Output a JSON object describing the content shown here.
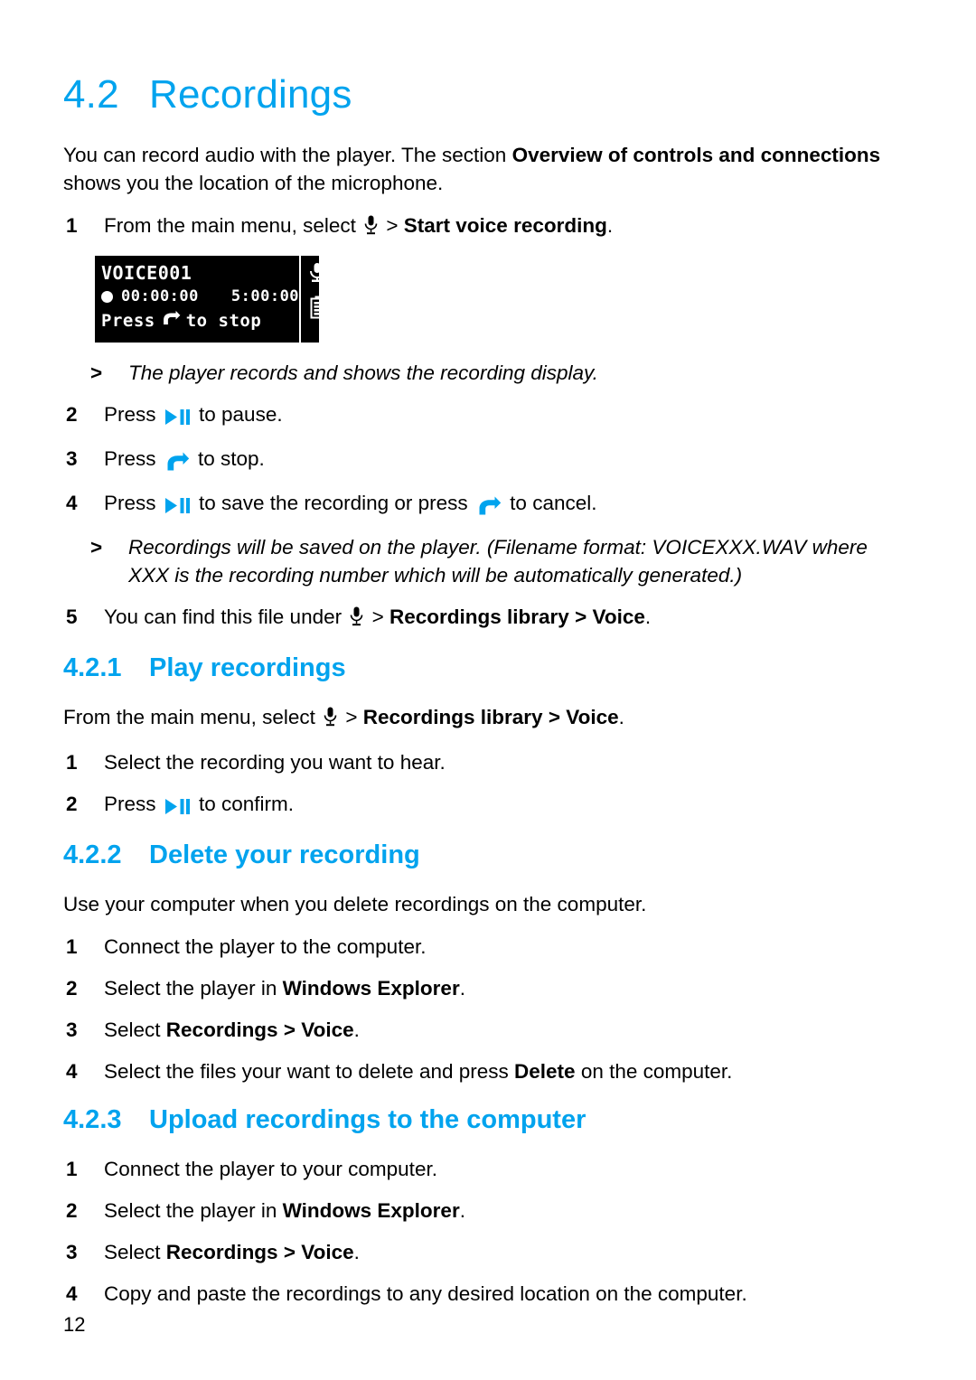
{
  "document": {
    "page_number": "12"
  },
  "section": {
    "number": "4.2",
    "title": "Recordings",
    "intro_part1": "You can record audio with the player. The section ",
    "intro_bold1": "Overview of controls and connections",
    "intro_part2": " shows you the location of the microphone."
  },
  "steps_record": [
    {
      "index": "1",
      "pre": "From the main menu, select ",
      "icon": "microphone-icon",
      "mid": " > ",
      "bold": "Start voice recording",
      "post": "."
    },
    {
      "index": "2",
      "pre": "Press ",
      "icon": "play-pause-icon",
      "post": " to pause."
    },
    {
      "index": "3",
      "pre": "Press ",
      "icon": "back-arrow-icon",
      "post": " to stop."
    },
    {
      "index": "4",
      "pre": "Press ",
      "icon": "play-pause-icon",
      "mid": " to save the recording or press ",
      "icon2": "back-arrow-icon",
      "post": " to cancel."
    },
    {
      "index": "5",
      "pre": "You can find this file under ",
      "icon": "microphone-icon",
      "mid": " > ",
      "bold": "Recordings library",
      "bold_sep": " > ",
      "bold2": "Voice",
      "post": "."
    }
  ],
  "notes": {
    "note1": "The player records and shows the recording display.",
    "note2": "Recordings will be saved on the player. (Filename format: VOICEXXX.WAV where XXX is the recording number which will be automatically generated.)",
    "bullet": ">"
  },
  "lcd": {
    "title": "VOICE001",
    "elapsed": "00:00:00",
    "remaining": "5:00:00",
    "hint_pre": "Press",
    "hint_icon": "back-arrow-icon",
    "hint_post": "to stop",
    "record_indicator": "record-dot-icon",
    "side_icons": [
      "microphone-icon",
      "battery-icon"
    ]
  },
  "subsection_play": {
    "number": "4.2.1",
    "title": "Play recordings",
    "intro_pre": "From the main menu, select ",
    "intro_icon": "microphone-icon",
    "intro_mid": " > ",
    "intro_bold": "Recordings library",
    "intro_bold_sep": " > ",
    "intro_bold2": "Voice",
    "intro_post": ".",
    "steps": [
      {
        "index": "1",
        "pre": "Select the recording you want to hear."
      },
      {
        "index": "2",
        "pre": "Press ",
        "icon": "play-pause-icon",
        "post": " to confirm."
      }
    ]
  },
  "subsection_delete": {
    "number": "4.2.2",
    "title": "Delete your recording",
    "intro": "Use your computer when you delete recordings on the computer.",
    "steps": [
      {
        "index": "1",
        "pre": "Connect the player to the computer."
      },
      {
        "index": "2",
        "pre": "Select the player in ",
        "bold": "Windows Explorer",
        "post": "."
      },
      {
        "index": "3",
        "pre": "Select ",
        "bold": "Recordings",
        "bold_sep": " > ",
        "bold2": "Voice",
        "post": "."
      },
      {
        "index": "4",
        "pre": "Select the files your want to delete and press ",
        "bold": "Delete",
        "post": " on the computer."
      }
    ]
  },
  "subsection_upload": {
    "number": "4.2.3",
    "title": "Upload recordings to the computer",
    "steps": [
      {
        "index": "1",
        "pre": "Connect the player to your computer."
      },
      {
        "index": "2",
        "pre": "Select the player in ",
        "bold": "Windows Explorer",
        "post": "."
      },
      {
        "index": "3",
        "pre": "Select ",
        "bold": "Recordings",
        "bold_sep": " > ",
        "bold2": "Voice",
        "post": "."
      },
      {
        "index": "4",
        "pre": "Copy and paste the recordings to any desired location on the computer."
      }
    ]
  },
  "colors": {
    "accent": "#00A3EE",
    "text": "#000000",
    "lcd_background": "#000000",
    "lcd_foreground": "#FFFFFF"
  }
}
